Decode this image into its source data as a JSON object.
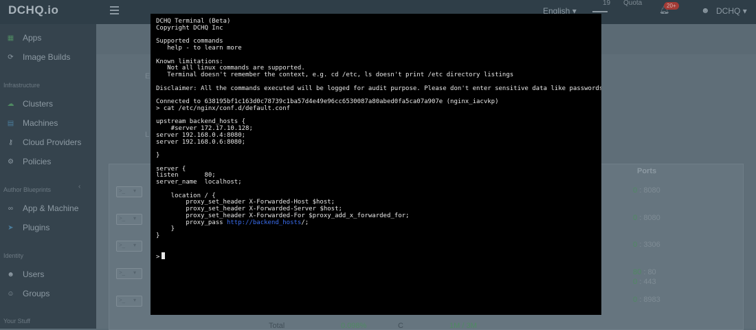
{
  "app": {
    "logo": "DCHQ.io"
  },
  "topbar": {
    "language": "English",
    "language_caret": "▾",
    "quota_number": "19",
    "quota_label": "Quota",
    "notification_count": "20+",
    "user": "DCHQ",
    "user_caret": "▾"
  },
  "sidebar": {
    "items_top": [
      {
        "label": "Apps",
        "icon": "apps-grid-icon"
      },
      {
        "label": "Image Builds",
        "icon": "refresh-icon"
      }
    ],
    "section_infra": "Infrastructure",
    "items_infra": [
      {
        "label": "Clusters",
        "icon": "cloud-icon"
      },
      {
        "label": "Machines",
        "icon": "server-icon"
      },
      {
        "label": "Cloud Providers",
        "icon": "key-icon"
      },
      {
        "label": "Policies",
        "icon": "gear-icon"
      }
    ],
    "section_blueprints": "Author Blueprints",
    "items_blueprints": [
      {
        "label": "App & Machine",
        "icon": "link-icon"
      },
      {
        "label": "Plugins",
        "icon": "plug-icon"
      }
    ],
    "section_identity": "Identity",
    "items_identity": [
      {
        "label": "Users",
        "icon": "user-icon"
      },
      {
        "label": "Groups",
        "icon": "users-icon"
      }
    ],
    "section_stuff": "Your Stuff"
  },
  "main": {
    "ghost_e": "E",
    "ghost_l": "L",
    "ports_header": "Ports",
    "rows": [
      {
        "btn": ">_",
        "port_a": "0",
        "sep": ":",
        "port_b": "8080",
        "port_a2": "",
        "port_b2": ""
      },
      {
        "btn": ">_",
        "port_a": "0",
        "sep": ":",
        "port_b": "8080",
        "port_a2": "",
        "port_b2": ""
      },
      {
        "btn": ">_",
        "port_a": "0",
        "sep": ":",
        "port_b": "3306",
        "port_a2": "",
        "port_b2": ""
      },
      {
        "btn": ">_",
        "port_a": "80",
        "sep": ":",
        "port_b": "80",
        "port_a2": "0",
        "port_b2": "443"
      },
      {
        "btn": ">_",
        "port_a": "0",
        "sep": ":",
        "port_b": "8983",
        "port_a2": "",
        "port_b2": ""
      }
    ],
    "total_label": "Total",
    "total_cpu": "0.098%",
    "total_c": "C",
    "total_mem": "1M / 3M"
  },
  "terminal": {
    "text": "DCHQ Terminal (Beta)\nCopyright DCHQ Inc\n\nSupported commands\n   help - to learn more\n\nKnown limitations:\n   Not all linux commands are supported.\n   Terminal doesn't remember the context, e.g. cd /etc, ls doesn't print /etc directory listings\n\nDisclaimer: All the commands executed will be logged for audit purpose. Please don't enter sensitive data like passwords on\n\nConnected to 638195bf1c163d0c78739c1ba57d4e49e96cc6530087a80abed0fa5ca07a907e (nginx_iacvkp)\n> cat /etc/nginx/conf.d/default.conf\n\nupstream backend_hosts {\n    #server 172.17.10.128;\nserver 192.168.0.4:8080;\nserver 192.168.0.6:8080;\n\n}\n\nserver {\nlisten       80;\nserver_name  localhost;\n\n    location / {\n        proxy_set_header X-Forwarded-Host $host;\n        proxy_set_header X-Forwarded-Server $host;\n        proxy_set_header X-Forwarded-For $proxy_add_x_forwarded_for;\n        proxy_pass ",
    "link": "http://backend_hosts",
    "text_after": "/;\n    }\n}",
    "prompt": ">"
  }
}
